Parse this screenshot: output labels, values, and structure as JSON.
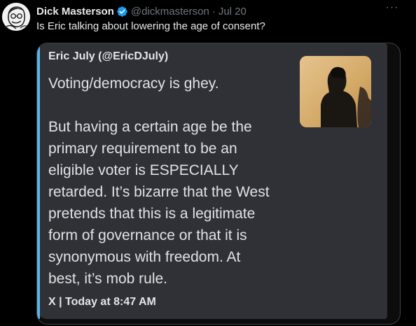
{
  "tweet": {
    "display_name": "Dick Masterson",
    "handle": "@dickmasterson",
    "separator": "·",
    "date": "Jul 20",
    "text": "Is Eric talking about lowering the age of consent?",
    "more_label": "···",
    "avatar_icon": "sketch-avatar-icon",
    "verified_icon": "verified-badge-icon",
    "verified_color": "#1d9bf0"
  },
  "quote": {
    "author": "Eric July (@EricDJuly)",
    "paragraph_1": "Voting/democracy is ghey.",
    "paragraph_2_lines": [
      "But having a certain age be the",
      "primary requirement to be an",
      "eligible voter is ESPECIALLY",
      "retarded. It’s bizarre that the West",
      "pretends that this is a legitimate",
      "form of governance or that it is",
      "synonymous with freedom. At",
      "best, it’s mob rule."
    ],
    "footer": "X | Today at 8:47 AM",
    "accent_color": "#5ab5e6",
    "thumbnail_icon": "profile-photo-thumbnail"
  }
}
